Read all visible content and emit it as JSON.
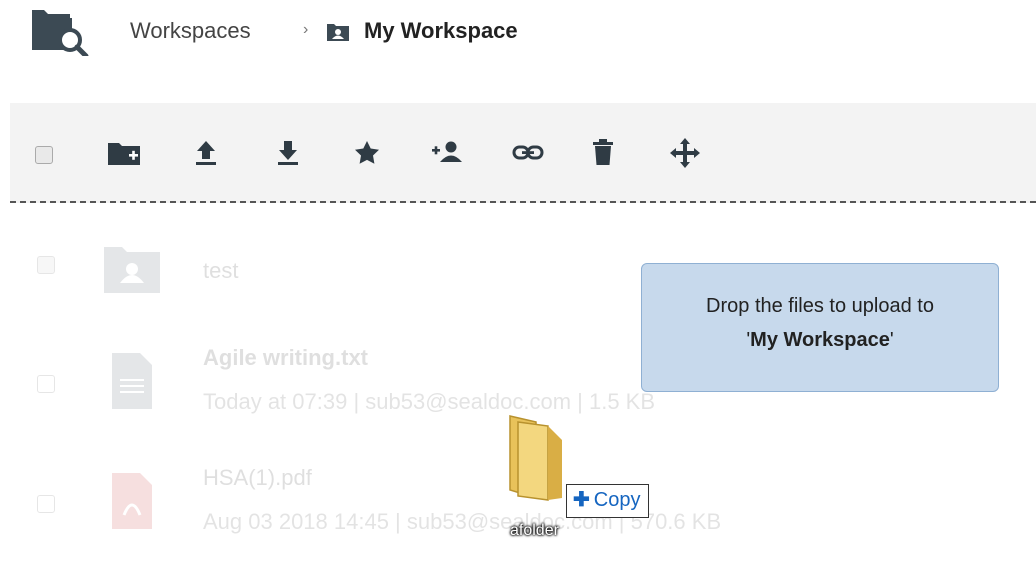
{
  "header": {
    "app_icon": "folder-search-icon",
    "breadcrumb_root": "Workspaces",
    "breadcrumb_separator": "›",
    "workspace_icon": "workspace-folder-icon",
    "breadcrumb_current": "My Workspace"
  },
  "toolbar": {
    "buttons": [
      {
        "name": "new-folder",
        "icon": "folder-plus-icon"
      },
      {
        "name": "upload",
        "icon": "upload-icon"
      },
      {
        "name": "download",
        "icon": "download-icon"
      },
      {
        "name": "favorite",
        "icon": "star-icon"
      },
      {
        "name": "share-user",
        "icon": "add-user-icon"
      },
      {
        "name": "share-link",
        "icon": "link-icon"
      },
      {
        "name": "delete",
        "icon": "trash-icon"
      },
      {
        "name": "move",
        "icon": "move-icon"
      }
    ]
  },
  "files": [
    {
      "name": "test",
      "meta": "",
      "type": "folder",
      "checked": true
    },
    {
      "name": "Agile writing.txt",
      "meta": "Today at 07:39 | sub53@sealdoc.com | 1.5 KB",
      "type": "txt",
      "checked": false
    },
    {
      "name": "HSA(1).pdf",
      "meta": "Aug 03 2018 14:45 | sub53@sealdoc.com | 570.6 KB",
      "type": "pdf",
      "checked": false
    }
  ],
  "drop_tip": {
    "line1": "Drop the files to upload to",
    "quote_open": "'",
    "workspace": "My Workspace",
    "quote_close": "'"
  },
  "drag": {
    "copy_label": "Copy",
    "item_label": "afolder"
  },
  "colors": {
    "toolbar_bg": "#f3f3f3",
    "icon": "#2f3b44",
    "tip_bg": "#c7d9ec",
    "copy_text": "#1565c0"
  }
}
